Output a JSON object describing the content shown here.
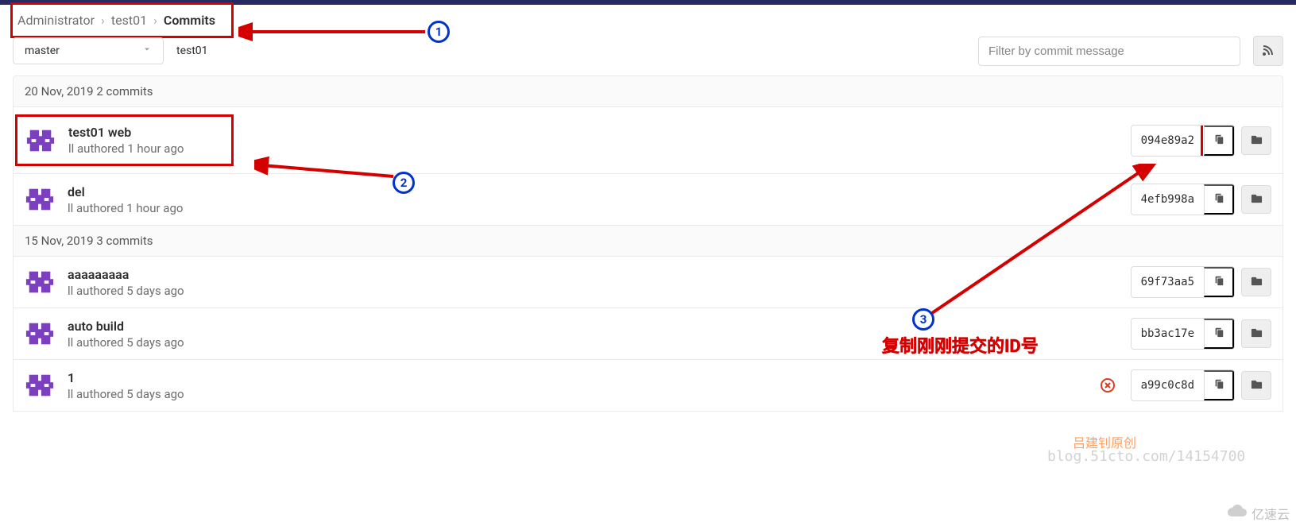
{
  "breadcrumb": {
    "items": [
      "Administrator",
      "test01",
      "Commits"
    ]
  },
  "toolbar": {
    "branch": "master",
    "repo": "test01",
    "filter_placeholder": "Filter by commit message"
  },
  "groups": [
    {
      "header": "20 Nov, 2019 2 commits",
      "commits": [
        {
          "title": "test01 web",
          "meta": "ll authored 1 hour ago",
          "sha": "094e89a2",
          "pipeline": null,
          "highlight": true,
          "copy_highlight": true
        },
        {
          "title": "del",
          "meta": "ll authored 1 hour ago",
          "sha": "4efb998a",
          "pipeline": null
        }
      ]
    },
    {
      "header": "15 Nov, 2019 3 commits",
      "commits": [
        {
          "title": "aaaaaaaaa",
          "meta": "ll authored 5 days ago",
          "sha": "69f73aa5",
          "pipeline": null
        },
        {
          "title": "auto build",
          "meta": "ll authored 5 days ago",
          "sha": "bb3ac17e",
          "pipeline": null
        },
        {
          "title": "1",
          "meta": "ll authored 5 days ago",
          "sha": "a99c0c8d",
          "pipeline": "failed"
        }
      ]
    }
  ],
  "annotations": {
    "marker1": "1",
    "marker2": "2",
    "marker3": "3",
    "note_text": "复制刚刚提交的ID号",
    "author_text": "吕建钊原创",
    "blog_text": "blog.51cto.com/14154700",
    "watermark": "亿速云"
  },
  "icon_colors": {
    "avatar": "#7b3fbf"
  }
}
